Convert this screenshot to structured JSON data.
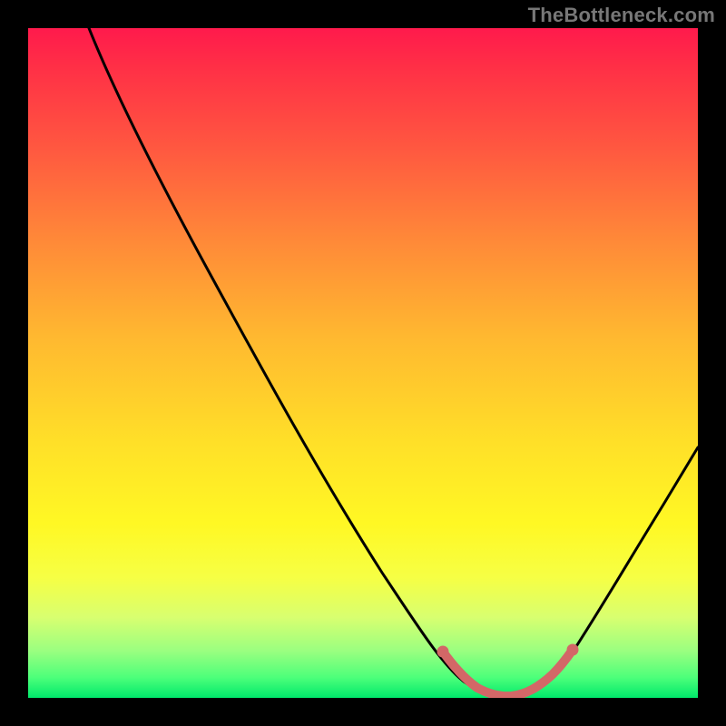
{
  "watermark": "TheBottleneck.com",
  "chart_data": {
    "type": "line",
    "title": "",
    "xlabel": "",
    "ylabel": "",
    "xlim": [
      0,
      100
    ],
    "ylim": [
      0,
      100
    ],
    "series": [
      {
        "name": "bottleneck-curve",
        "x": [
          9,
          15,
          25,
          35,
          45,
          55,
          62,
          65,
          68,
          72,
          75,
          78,
          82,
          88,
          94,
          100
        ],
        "y": [
          100,
          89,
          71,
          53,
          36,
          19,
          7,
          3,
          1,
          0.5,
          1,
          3,
          8,
          17,
          27,
          37
        ]
      }
    ],
    "highlight": {
      "name": "optimal-range",
      "points": [
        {
          "x": 62,
          "y": 7
        },
        {
          "x": 65,
          "y": 3
        },
        {
          "x": 68,
          "y": 1.2
        },
        {
          "x": 71,
          "y": 0.7
        },
        {
          "x": 74,
          "y": 0.9
        },
        {
          "x": 77,
          "y": 2.5
        },
        {
          "x": 80,
          "y": 5.5
        }
      ],
      "color": "#d36767"
    },
    "background_gradient": [
      "#ff1a4c",
      "#ff5840",
      "#ffb830",
      "#fff824",
      "#9aff80",
      "#00e86b"
    ]
  }
}
